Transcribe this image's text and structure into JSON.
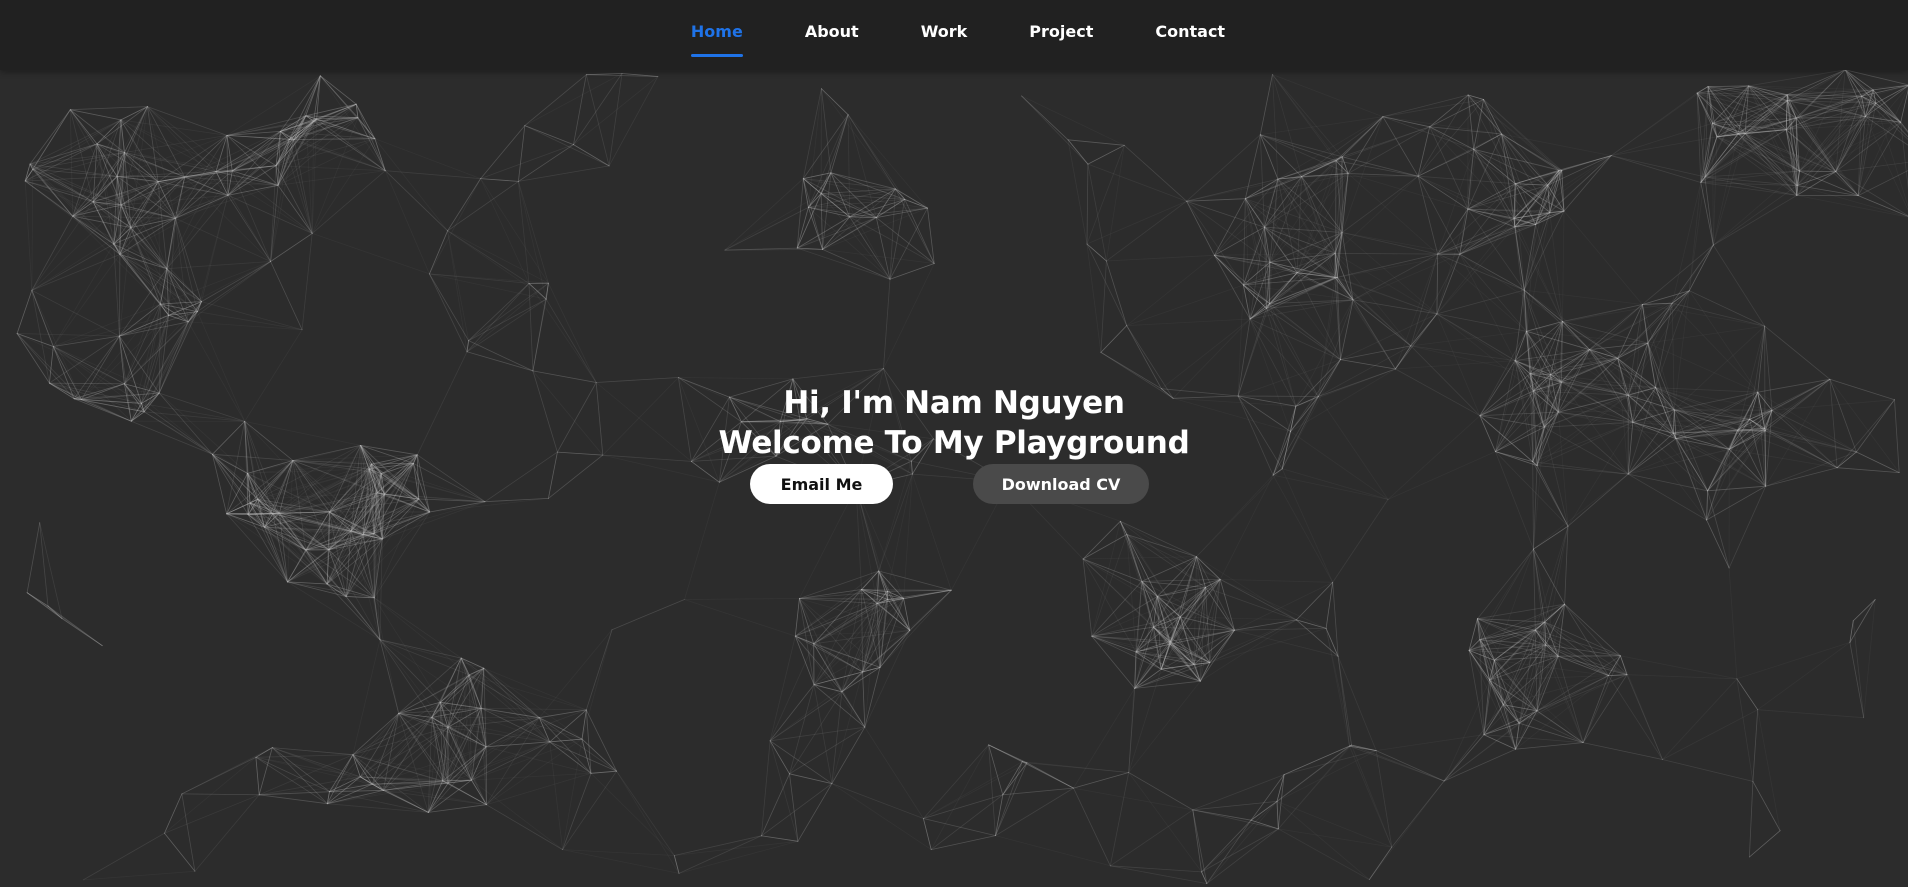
{
  "nav": {
    "items": [
      {
        "label": "Home",
        "active": true
      },
      {
        "label": "About",
        "active": false
      },
      {
        "label": "Work",
        "active": false
      },
      {
        "label": "Project",
        "active": false
      },
      {
        "label": "Contact",
        "active": false
      }
    ]
  },
  "hero": {
    "line1": "Hi, I'm Nam Nguyen",
    "line2": "Welcome To My Playground",
    "email_button": "Email Me",
    "cv_button": "Download CV"
  },
  "colors": {
    "background": "#2c2c2c",
    "navbar": "#212121",
    "accent": "#1f73e8",
    "network_lines": "#bdbdbd",
    "primary_button": "#ffffff",
    "secondary_button": "#4a4a4a"
  }
}
